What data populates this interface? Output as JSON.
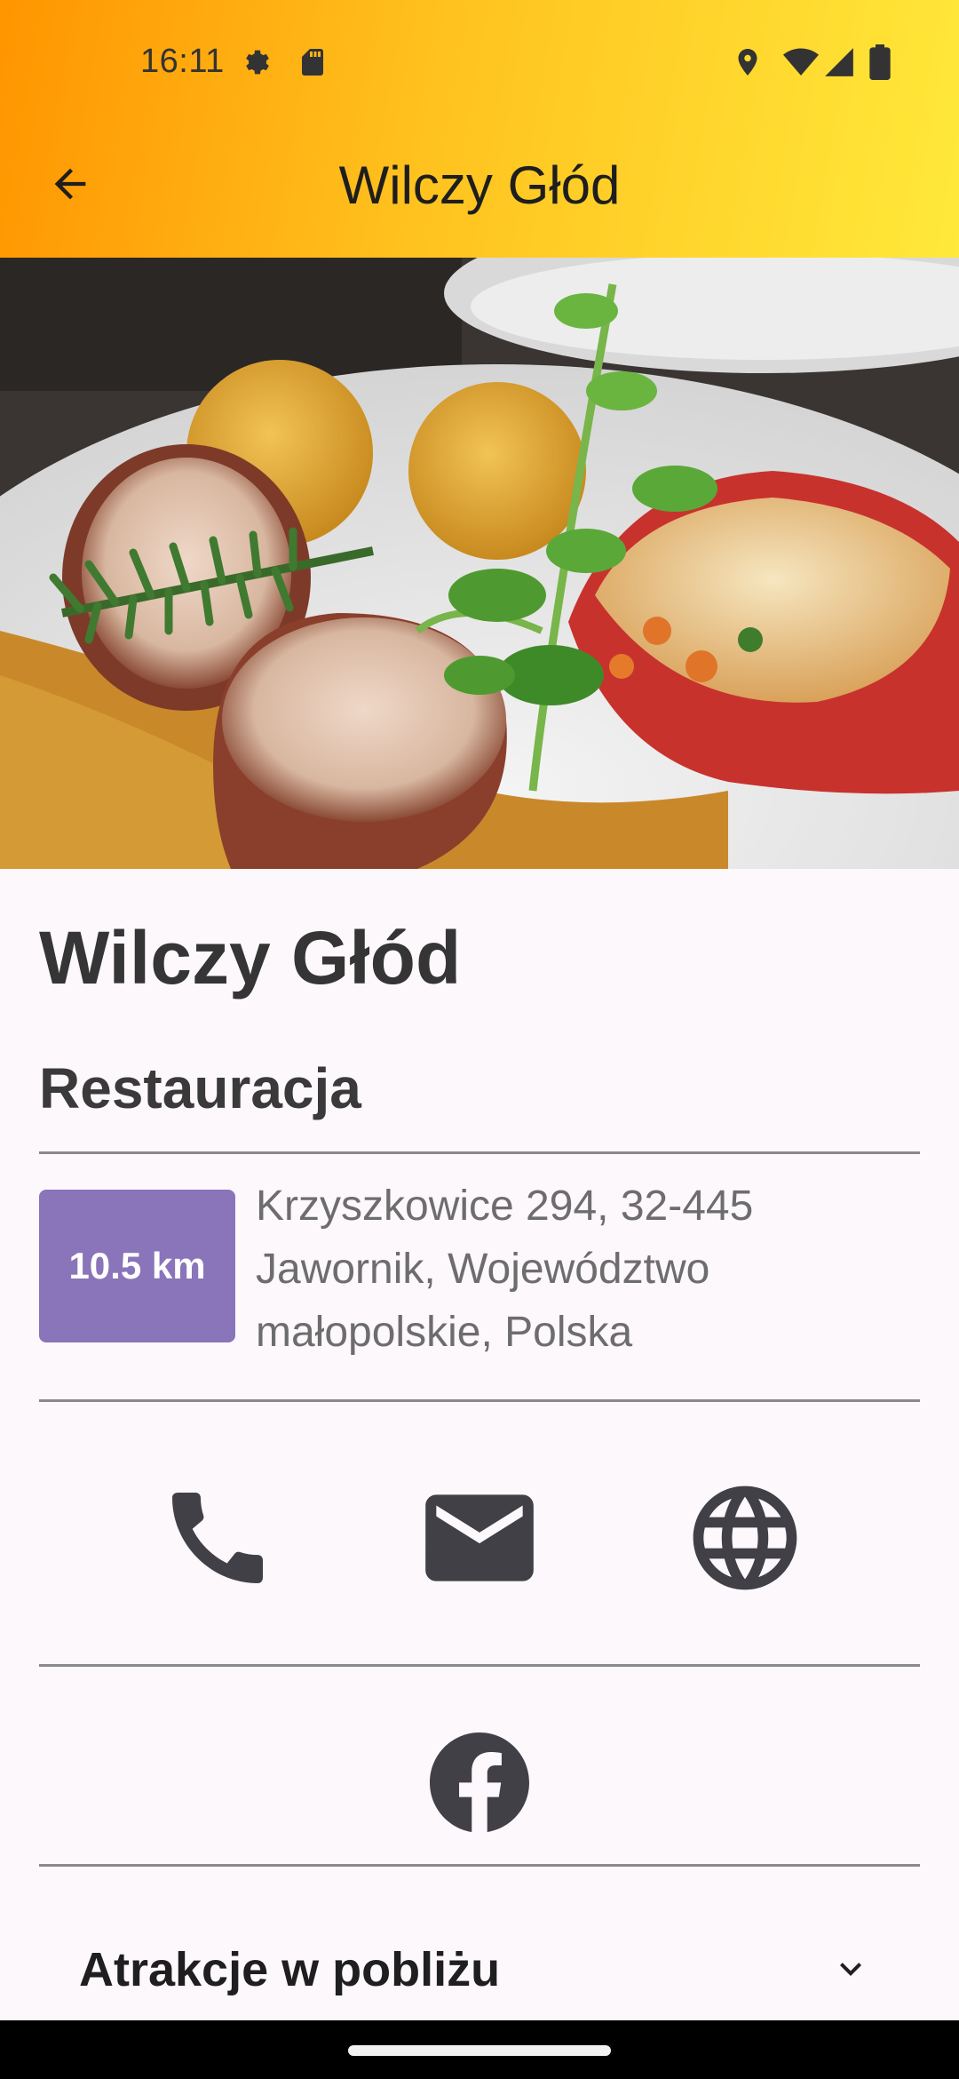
{
  "status_bar": {
    "time": "16:11",
    "left_icons": [
      "settings-gear-icon",
      "sd-card-icon"
    ],
    "right_icons": [
      "location-pin-icon",
      "wifi-icon",
      "signal-icon",
      "battery-icon"
    ]
  },
  "toolbar": {
    "back_icon": "arrow-back-icon",
    "title": "Wilczy Głód",
    "gradient_colors": [
      "#ff9500",
      "#ffe93a"
    ]
  },
  "place": {
    "name": "Wilczy Głód",
    "type": "Restauracja",
    "distance": "10.5 km",
    "address": "Krzyszkowice 294,  32-445 Jawornik, Województwo małopolskie, Polska",
    "badge_color": "#8a74ba"
  },
  "contacts": {
    "icons": [
      "phone-icon",
      "mail-icon",
      "web-globe-icon"
    ],
    "social_icons": [
      "facebook-icon"
    ],
    "icon_color": "#414046"
  },
  "nearby": {
    "title": "Atrakcje w pobliżu",
    "expand_icon": "chevron-down-icon"
  }
}
